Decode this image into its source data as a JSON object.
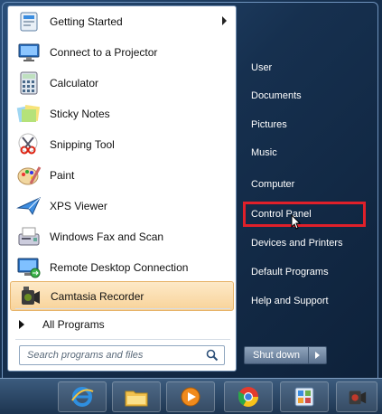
{
  "programs": [
    {
      "label": "Getting Started",
      "icon": "getting-started-icon",
      "has_submenu": true
    },
    {
      "label": "Connect to a Projector",
      "icon": "projector-icon"
    },
    {
      "label": "Calculator",
      "icon": "calculator-icon"
    },
    {
      "label": "Sticky Notes",
      "icon": "sticky-notes-icon"
    },
    {
      "label": "Snipping Tool",
      "icon": "snipping-tool-icon"
    },
    {
      "label": "Paint",
      "icon": "paint-icon"
    },
    {
      "label": "XPS Viewer",
      "icon": "xps-viewer-icon"
    },
    {
      "label": "Windows Fax and Scan",
      "icon": "fax-scan-icon"
    },
    {
      "label": "Remote Desktop Connection",
      "icon": "remote-desktop-icon"
    },
    {
      "label": "Camtasia Recorder",
      "icon": "camtasia-recorder-icon",
      "highlighted": true
    }
  ],
  "all_programs_label": "All Programs",
  "search": {
    "placeholder": "Search programs and files"
  },
  "right_items": [
    {
      "label": "User"
    },
    {
      "label": "Documents"
    },
    {
      "label": "Pictures"
    },
    {
      "label": "Music"
    },
    {
      "label": "Computer"
    },
    {
      "label": "Control Panel",
      "outlined": true
    },
    {
      "label": "Devices and Printers"
    },
    {
      "label": "Default Programs"
    },
    {
      "label": "Help and Support"
    }
  ],
  "shutdown_label": "Shut down",
  "taskbar": [
    "internet-explorer-icon",
    "windows-explorer-icon",
    "media-player-icon",
    "chrome-icon",
    "control-panel-taskbar-icon",
    "camtasia-taskbar-icon"
  ],
  "colors": {
    "highlight_outline": "#e0202a",
    "hover": "#f8d39a"
  }
}
